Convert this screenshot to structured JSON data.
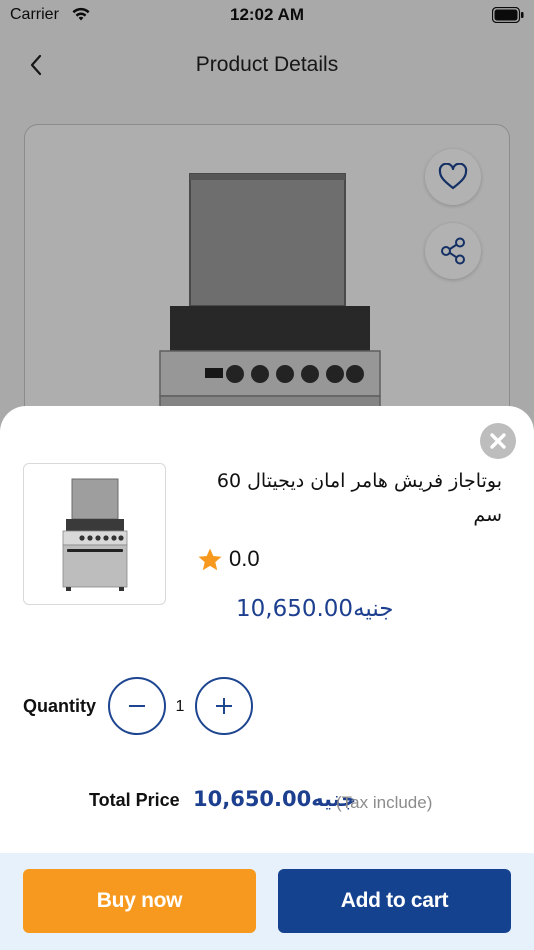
{
  "status_bar": {
    "carrier": "Carrier",
    "time": "12:02 AM"
  },
  "nav": {
    "title": "Product Details"
  },
  "product": {
    "name": "بوتاجاز فريش هامر امان ديجيتال 60 سم",
    "rating": "0.0",
    "price": "10,650.00جنيه"
  },
  "quantity": {
    "label": "Quantity",
    "value": "1"
  },
  "total": {
    "label": "Total Price",
    "value": "10,650.00جنيه",
    "tax_note": "(Tax include)"
  },
  "actions": {
    "buy_now": "Buy now",
    "add_to_cart": "Add to cart"
  },
  "colors": {
    "primary": "#15428f",
    "accent": "#f7991e",
    "price": "#1d3f8f",
    "star": "#f7991e"
  },
  "icons": [
    "wifi-icon",
    "battery-icon",
    "back-chevron-icon",
    "heart-icon",
    "share-icon",
    "close-icon",
    "star-icon",
    "minus-icon",
    "plus-icon"
  ]
}
